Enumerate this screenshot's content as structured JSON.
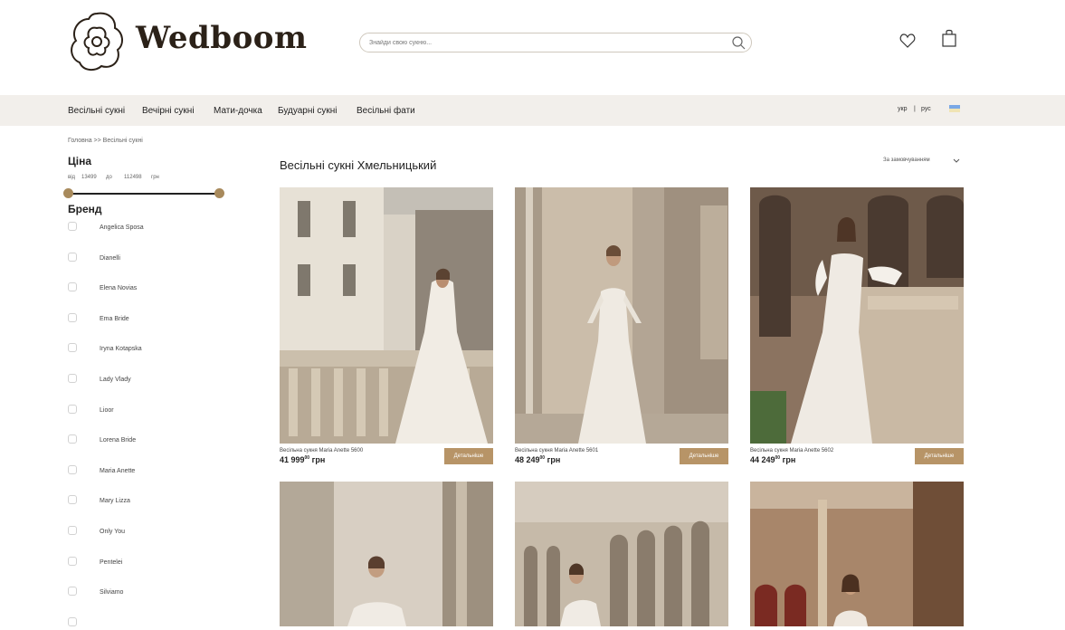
{
  "header": {
    "logo_text": "Wedboom",
    "search_placeholder": "Знайди свою сукню..."
  },
  "nav": {
    "items": [
      "Весільні сукні",
      "Вечірні сукні",
      "Мати-дочка",
      "Будуарні сукні",
      "Весільні фати"
    ],
    "lang_ukr": "укр",
    "lang_sep": "|",
    "lang_rus": "рус"
  },
  "breadcrumb": "Головна >> Весільні сукні",
  "filters": {
    "price_title": "Ціна",
    "from_label": "від",
    "from_value": "13499",
    "to_label": "до",
    "to_value": "112498",
    "currency": "грн",
    "range": [
      0,
      1
    ],
    "brand_title": "Бренд",
    "brands": [
      "Angelica Sposa",
      "Dianelli",
      "Elena Novias",
      "Ema Bride",
      "Iryna Kotapska",
      "Lady Vlady",
      "Lioor",
      "Lorena Bride",
      "Maria Anette",
      "Mary Lizza",
      "Only You",
      "Pentelei",
      "Silviamo",
      ""
    ]
  },
  "main": {
    "title": "Весільні сукні Хмельницький",
    "sort_label": "За замовчуванням"
  },
  "products": [
    {
      "title": "Весільна сукня Maria Anette 5600",
      "price": "41 999",
      "cents": "00",
      "currency": "грн",
      "button": "Детальніше"
    },
    {
      "title": "Весільна сукня Maria Anette 5601",
      "price": "48 249",
      "cents": "00",
      "currency": "грн",
      "button": "Детальніше"
    },
    {
      "title": "Весільна сукня Maria Anette 5602",
      "price": "44 249",
      "cents": "00",
      "currency": "грн",
      "button": "Детальніше"
    }
  ],
  "colors": {
    "accent": "#b79467",
    "nav_bg": "#f2efeb",
    "knob": "#a88a5c"
  }
}
